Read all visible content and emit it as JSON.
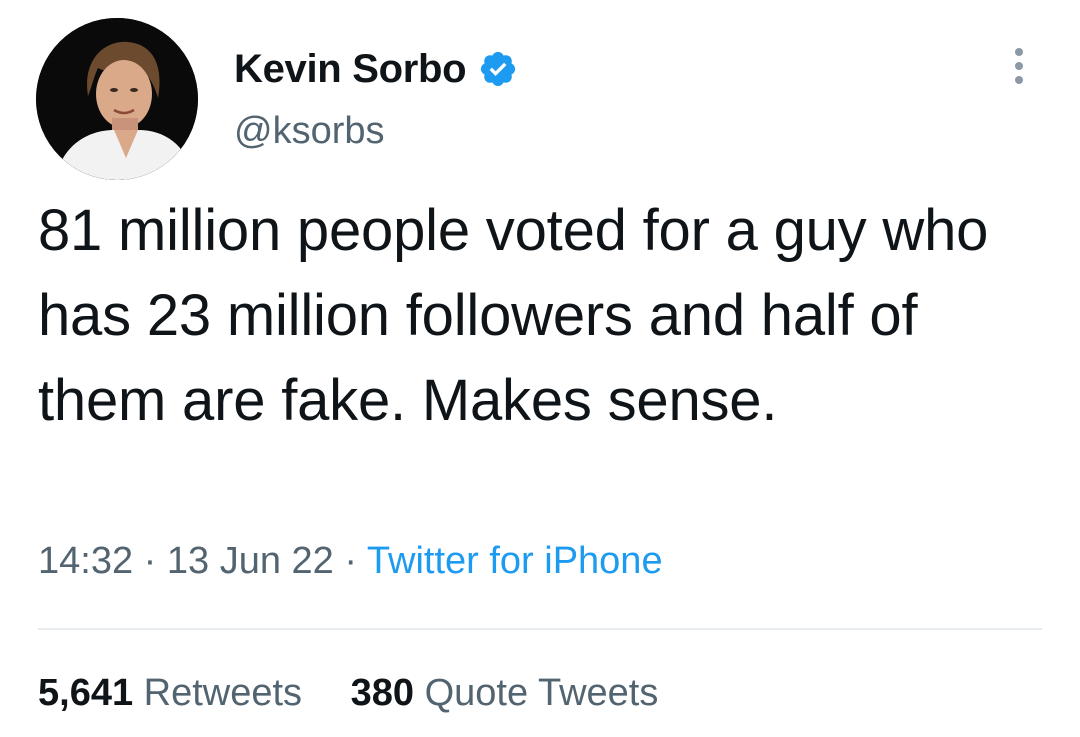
{
  "author": {
    "display_name": "Kevin Sorbo",
    "handle": "@ksorbs",
    "avatar_icon": "avatar-photo",
    "verified_icon": "verified-badge-icon"
  },
  "tweet": {
    "text": "81 million people voted for a guy who has 23 million followers and half of them are fake. Makes sense.",
    "time": "14:32",
    "date": "13 Jun 22",
    "separator": "·",
    "source": "Twitter for iPhone"
  },
  "stats": {
    "retweets_count": "5,641",
    "retweets_label": "Retweets",
    "quotes_count": "380",
    "quotes_label": "Quote Tweets"
  },
  "colors": {
    "text_primary": "#0f1419",
    "text_secondary": "#536471",
    "accent": "#1d9bf0",
    "divider": "#e6ecf0"
  },
  "icons": {
    "more": "more-options-icon"
  }
}
